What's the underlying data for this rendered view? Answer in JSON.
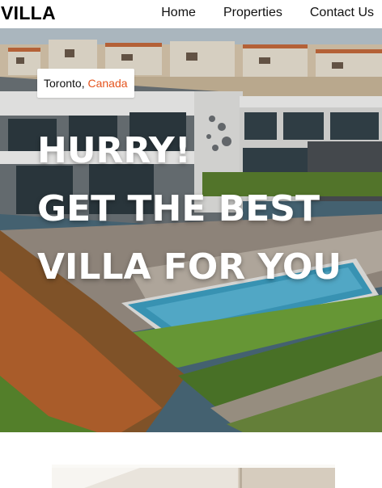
{
  "header": {
    "logo": "VILLA",
    "nav": [
      {
        "label": "Home"
      },
      {
        "label": "Properties"
      },
      {
        "label": "Contact Us"
      }
    ]
  },
  "hero": {
    "location": {
      "city": "Toronto,",
      "country": "Canada"
    },
    "headline": [
      "HURRY!",
      "GET THE BEST",
      "VILLA FOR YOU"
    ]
  },
  "colors": {
    "accent": "#e5541e",
    "heading": "#ffffff",
    "pool": "#3d9fc2",
    "lawn": "#6fa33a"
  }
}
